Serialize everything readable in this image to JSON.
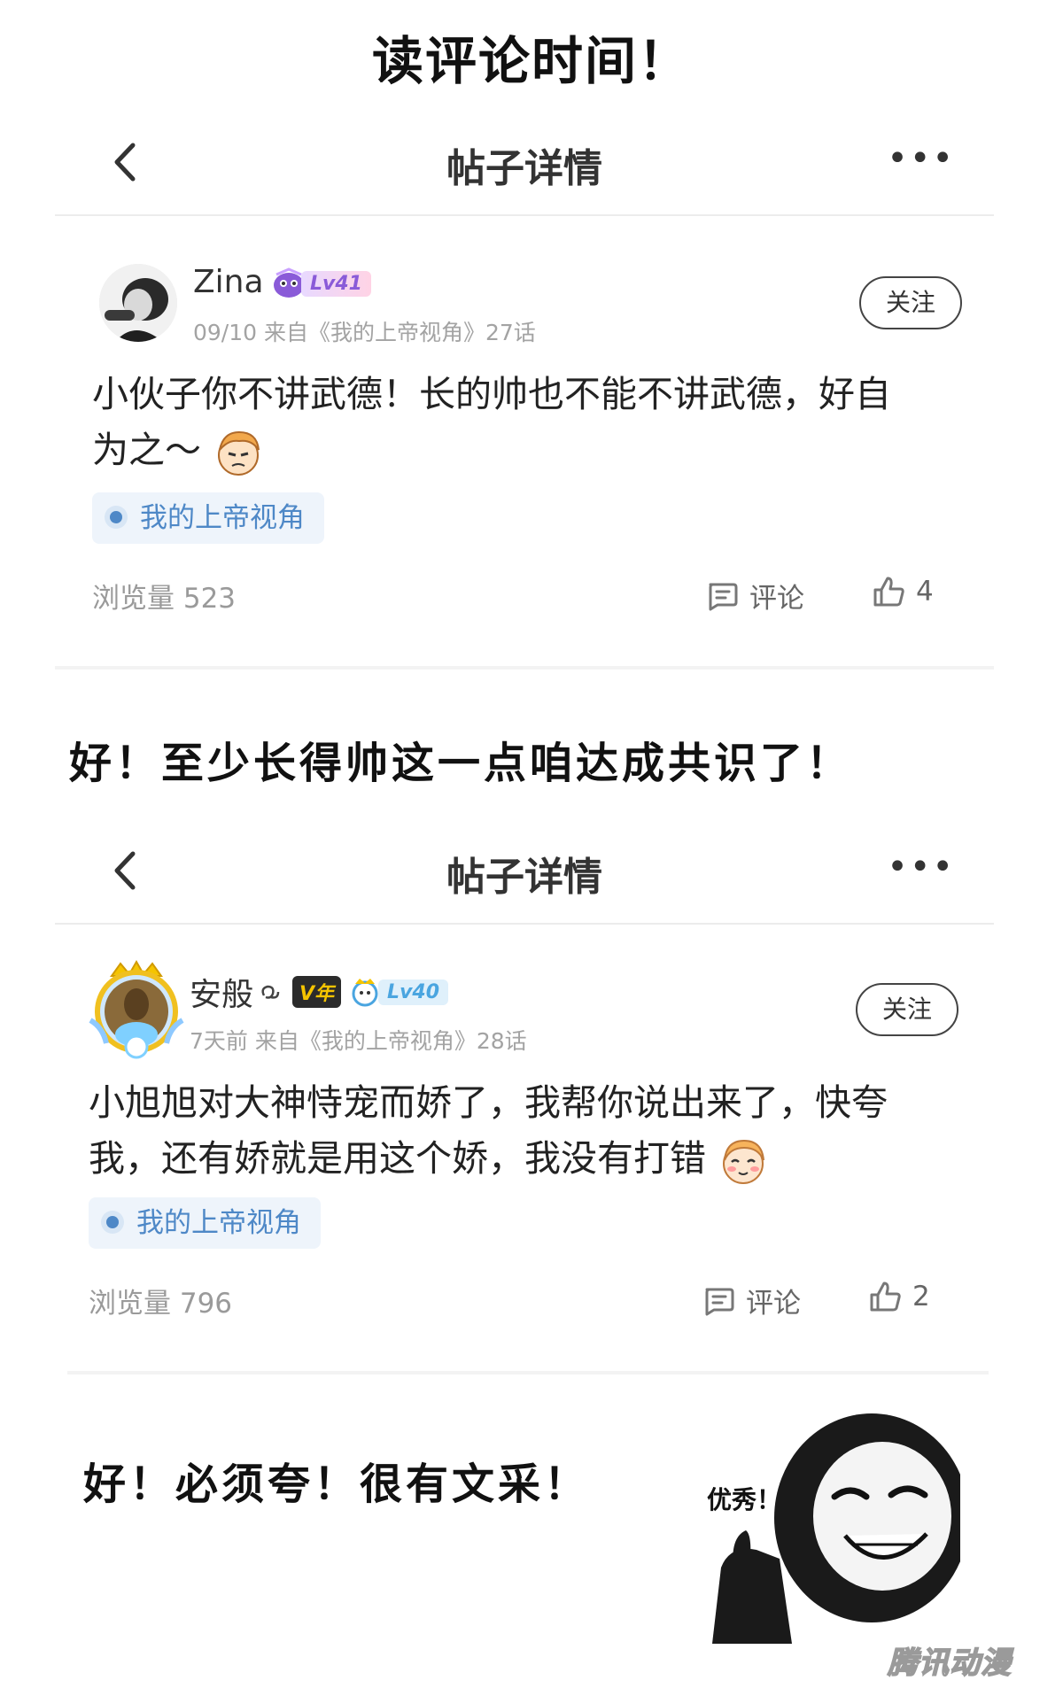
{
  "page_title": "读评论时间！",
  "caption_1": "好！至少长得帅这一点咱达成共识了！",
  "caption_2": "好！必须夸！很有文采！",
  "meme_text": "优秀！",
  "watermark": "腾讯动漫",
  "posts": [
    {
      "nav_title": "帖子详情",
      "nav_more": "•••",
      "user": "Zina",
      "level": "Lv41",
      "meta": "09/10 来自《我的上帝视角》27话",
      "follow": "关注",
      "content_line1": "小伙子你不讲武德！长的帅也不能不讲武德，好自",
      "content_line2": "为之～",
      "tag": "我的上帝视角",
      "views": "浏览量 523",
      "comment": "评论",
      "likes": "4"
    },
    {
      "nav_title": "帖子详情",
      "nav_more": "•••",
      "user": "安般",
      "vip": "V年",
      "level": "Lv40",
      "meta": "7天前 来自《我的上帝视角》28话",
      "follow": "关注",
      "content_line1": "小旭旭对大神恃宠而娇了，我帮你说出来了，快夸",
      "content_line2": "我，还有娇就是用这个娇，我没有打错",
      "tag": "我的上帝视角",
      "views": "浏览量 796",
      "comment": "评论",
      "likes": "2"
    }
  ],
  "colors": {
    "tag_blue": "#4e88c7",
    "lv_purple": "#8a5bd8",
    "lv_blue": "#4aa5e0",
    "vip_yellow": "#f5c400"
  }
}
